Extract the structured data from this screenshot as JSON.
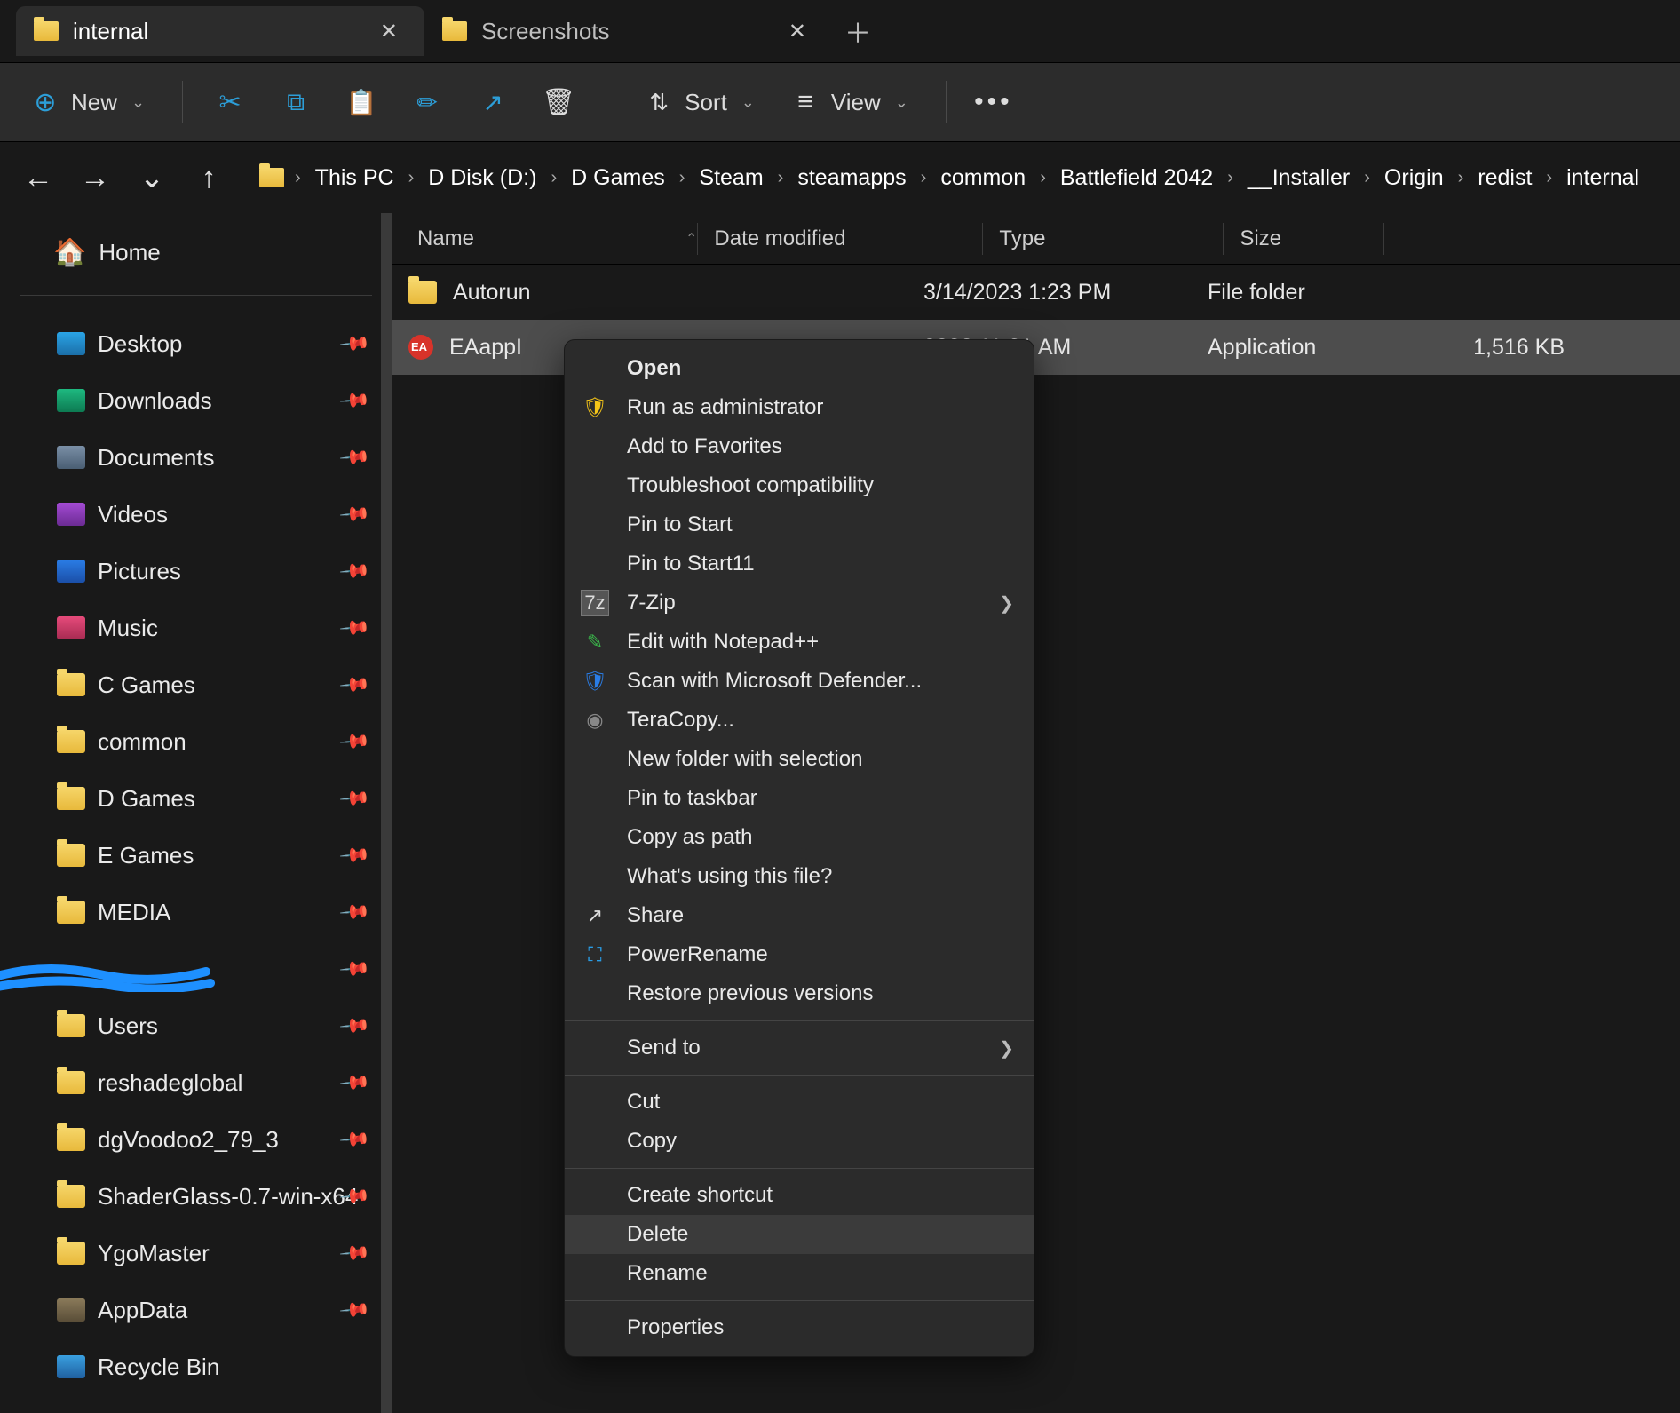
{
  "tabs": [
    {
      "title": "internal",
      "active": true
    },
    {
      "title": "Screenshots",
      "active": false
    }
  ],
  "toolbar": {
    "new_label": "New",
    "sort_label": "Sort",
    "view_label": "View"
  },
  "breadcrumb": [
    "This PC",
    "D Disk (D:)",
    "D Games",
    "Steam",
    "steamapps",
    "common",
    "Battlefield 2042",
    "__Installer",
    "Origin",
    "redist",
    "internal"
  ],
  "columns": {
    "name": "Name",
    "date": "Date modified",
    "type": "Type",
    "size": "Size"
  },
  "sidebar": {
    "home": "Home",
    "items": [
      {
        "label": "Desktop",
        "icon": "desktop",
        "pinned": true
      },
      {
        "label": "Downloads",
        "icon": "downloads",
        "pinned": true
      },
      {
        "label": "Documents",
        "icon": "documents",
        "pinned": true
      },
      {
        "label": "Videos",
        "icon": "videos",
        "pinned": true
      },
      {
        "label": "Pictures",
        "icon": "pictures",
        "pinned": true
      },
      {
        "label": "Music",
        "icon": "music",
        "pinned": true
      },
      {
        "label": "C Games",
        "icon": "folder",
        "pinned": true
      },
      {
        "label": "common",
        "icon": "folder",
        "pinned": true
      },
      {
        "label": "D Games",
        "icon": "folder",
        "pinned": true
      },
      {
        "label": "E Games",
        "icon": "folder",
        "pinned": true
      },
      {
        "label": "MEDIA",
        "icon": "folder",
        "pinned": true
      },
      {
        "label": "",
        "icon": "redacted",
        "pinned": true
      },
      {
        "label": "Users",
        "icon": "folder",
        "pinned": true
      },
      {
        "label": "reshadeglobal",
        "icon": "folder",
        "pinned": true
      },
      {
        "label": "dgVoodoo2_79_3",
        "icon": "folder",
        "pinned": true
      },
      {
        "label": "ShaderGlass-0.7-win-x64",
        "icon": "folder",
        "pinned": true
      },
      {
        "label": "YgoMaster",
        "icon": "folder",
        "pinned": true
      },
      {
        "label": "AppData",
        "icon": "blank",
        "pinned": true
      },
      {
        "label": "Recycle Bin",
        "icon": "recycle",
        "pinned": false
      }
    ]
  },
  "files": [
    {
      "name": "Autorun",
      "date": "3/14/2023 1:23 PM",
      "type": "File folder",
      "size": "",
      "icon": "folder",
      "selected": false
    },
    {
      "name": "EAappI",
      "date": "2023 11:21 AM",
      "type": "Application",
      "size": "1,516 KB",
      "icon": "app",
      "selected": true
    }
  ],
  "context_menu": {
    "groups": [
      [
        {
          "label": "Open",
          "bold": true,
          "icon": ""
        },
        {
          "label": "Run as administrator",
          "icon": "shield"
        },
        {
          "label": "Add to Favorites",
          "icon": ""
        },
        {
          "label": "Troubleshoot compatibility",
          "icon": ""
        },
        {
          "label": "Pin to Start",
          "icon": ""
        },
        {
          "label": "Pin to Start11",
          "icon": ""
        },
        {
          "label": "7-Zip",
          "icon": "sz",
          "submenu": true
        },
        {
          "label": "Edit with Notepad++",
          "icon": "np"
        },
        {
          "label": "Scan with Microsoft Defender...",
          "icon": "defend"
        },
        {
          "label": "TeraCopy...",
          "icon": "tera"
        },
        {
          "label": "New folder with selection",
          "icon": ""
        },
        {
          "label": "Pin to taskbar",
          "icon": ""
        },
        {
          "label": "Copy as path",
          "icon": ""
        },
        {
          "label": "What's using this file?",
          "icon": ""
        },
        {
          "label": "Share",
          "icon": "share-i"
        },
        {
          "label": "PowerRename",
          "icon": "pr"
        },
        {
          "label": "Restore previous versions",
          "icon": ""
        }
      ],
      [
        {
          "label": "Send to",
          "icon": "",
          "submenu": true
        }
      ],
      [
        {
          "label": "Cut",
          "icon": ""
        },
        {
          "label": "Copy",
          "icon": ""
        }
      ],
      [
        {
          "label": "Create shortcut",
          "icon": ""
        },
        {
          "label": "Delete",
          "icon": "",
          "hover": true
        },
        {
          "label": "Rename",
          "icon": ""
        }
      ],
      [
        {
          "label": "Properties",
          "icon": ""
        }
      ]
    ]
  }
}
